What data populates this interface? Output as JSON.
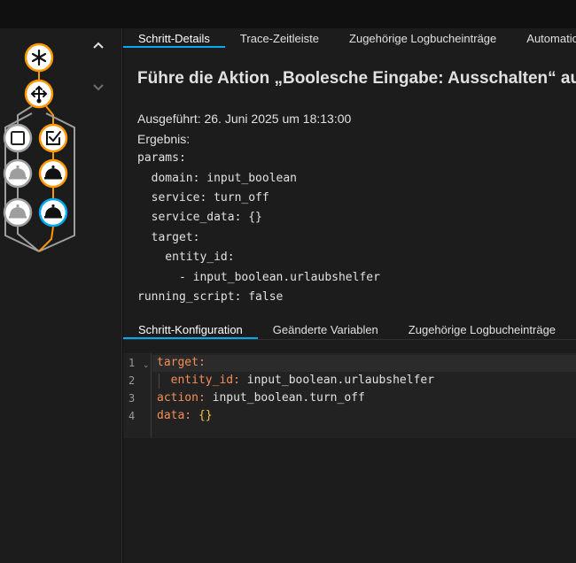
{
  "tabs_top": [
    "Schritt-Details",
    "Trace-Zeitleiste",
    "Zugehörige Logbucheinträge",
    "Automation-Konfiguration"
  ],
  "title": "Führe die Aktion „Boolesche Eingabe: Ausschalten“ aus",
  "executed": "Ausgeführt: 26. Juni 2025 um 18:13:00",
  "result_label": "Ergebnis:",
  "result_yaml": [
    "params:",
    "  domain: input_boolean",
    "  service: turn_off",
    "  service_data: {}",
    "  target:",
    "    entity_id:",
    "      - input_boolean.urlaubshelfer",
    "running_script: false"
  ],
  "tabs_bottom": [
    "Schritt-Konfiguration",
    "Geänderte Variablen",
    "Zugehörige Logbucheinträge"
  ],
  "editor": {
    "line_numbers": [
      "1",
      "2",
      "3",
      "4"
    ],
    "lines": [
      {
        "key": "target:",
        "value": ""
      },
      {
        "key": "  entity_id:",
        "value": " input_boolean.urlaubshelfer"
      },
      {
        "key": "action:",
        "value": " input_boolean.turn_off"
      },
      {
        "key": "data:",
        "value": " {}"
      }
    ]
  },
  "graph": {
    "accent_color": "#ff9800",
    "inactive_color": "#9e9e9e",
    "selected_color": "#03a9f4",
    "nodes": [
      "asterisk-icon",
      "shuffle-icon",
      "square-outline-icon",
      "checkbox-marked-icon",
      "bell-icon",
      "bell-icon",
      "bell-icon",
      "bell-icon"
    ]
  }
}
